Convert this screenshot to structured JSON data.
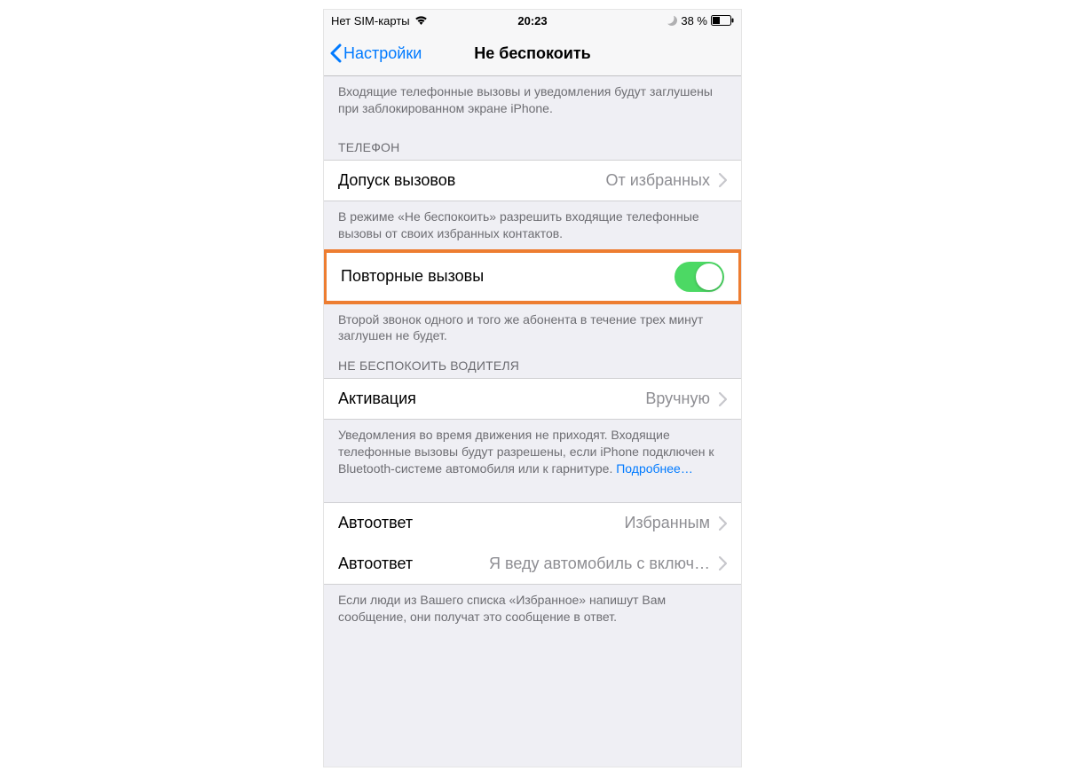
{
  "status": {
    "carrier": "Нет SIM-карты",
    "time": "20:23",
    "battery_pct": "38 %"
  },
  "nav": {
    "back_label": "Настройки",
    "title": "Не беспокоить"
  },
  "top_desc": "Входящие телефонные вызовы и уведомления будут заглушены при заблокированном экране iPhone.",
  "section_phone": {
    "header": "ТЕЛЕФОН",
    "allow_calls": {
      "label": "Допуск вызовов",
      "value": "От избранных"
    },
    "allow_desc": "В режиме «Не беспокоить» разрешить входящие телефонные вызовы от своих избранных контактов.",
    "repeated_calls": {
      "label": "Повторные вызовы",
      "on": true
    },
    "repeated_desc": "Второй звонок одного и того же абонента в течение трех минут заглушен не будет."
  },
  "section_driving": {
    "header": "НЕ БЕСПОКОИТЬ ВОДИТЕЛЯ",
    "activation": {
      "label": "Активация",
      "value": "Вручную"
    },
    "activation_desc": "Уведомления во время движения не приходят. Входящие телефонные вызовы будут разрешены, если iPhone подключен к Bluetooth-системе автомобиля или к гарнитуре. ",
    "more_link": "Подробнее…"
  },
  "autoresponse": {
    "row1": {
      "label": "Автоответ",
      "value": "Избранным"
    },
    "row2": {
      "label": "Автоответ",
      "value": "Я веду автомобиль с включ…"
    },
    "desc": "Если люди из Вашего списка «Избранное» напишут Вам сообщение, они получат это сообщение в ответ."
  }
}
